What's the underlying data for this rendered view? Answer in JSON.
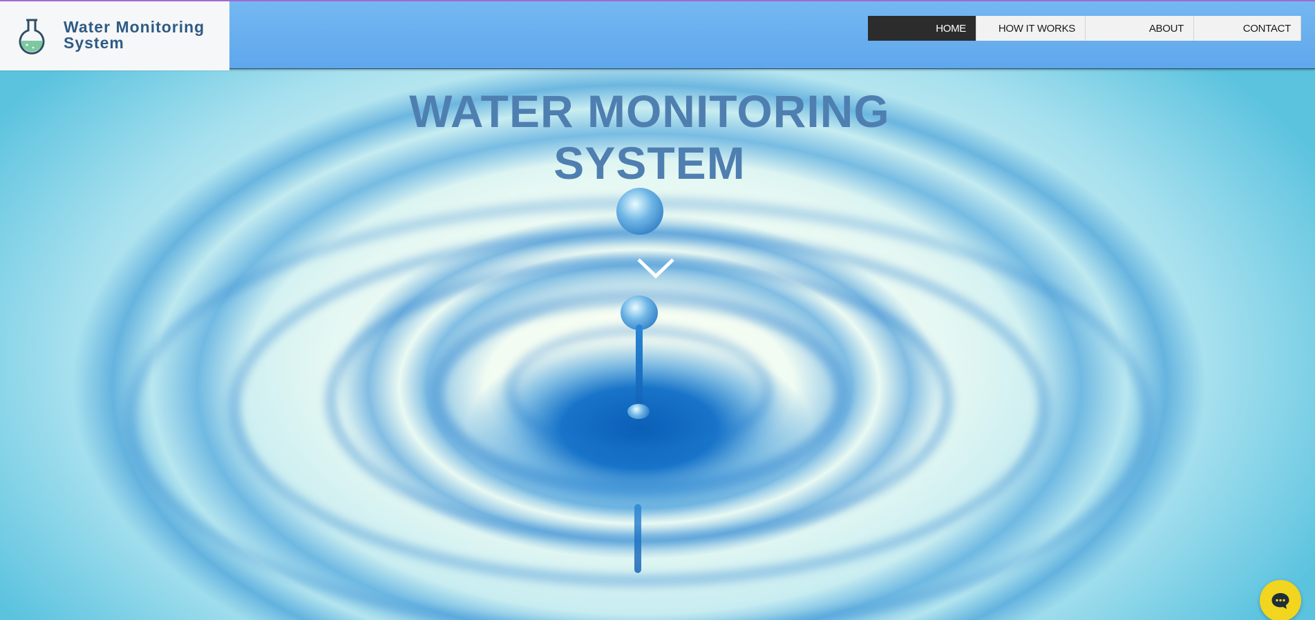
{
  "site": {
    "name": "Water Monitoring\nSystem",
    "logo_icon": "flask-icon"
  },
  "nav": {
    "items": [
      {
        "label": "HOME",
        "active": true
      },
      {
        "label": "HOW IT WORKS",
        "active": false
      },
      {
        "label": "ABOUT",
        "active": false
      },
      {
        "label": "CONTACT",
        "active": false
      }
    ]
  },
  "hero": {
    "title_line1": "WATER MONITORING",
    "title_line2": "SYSTEM",
    "scroll_icon": "chevron-down-icon"
  },
  "chat": {
    "icon": "chat-bubble-icon"
  },
  "colors": {
    "header_blue": "#6aaff0",
    "nav_active_bg": "#2c2c2c",
    "title_blue": "#4f7fb0",
    "chat_yellow": "#f2d51e"
  }
}
